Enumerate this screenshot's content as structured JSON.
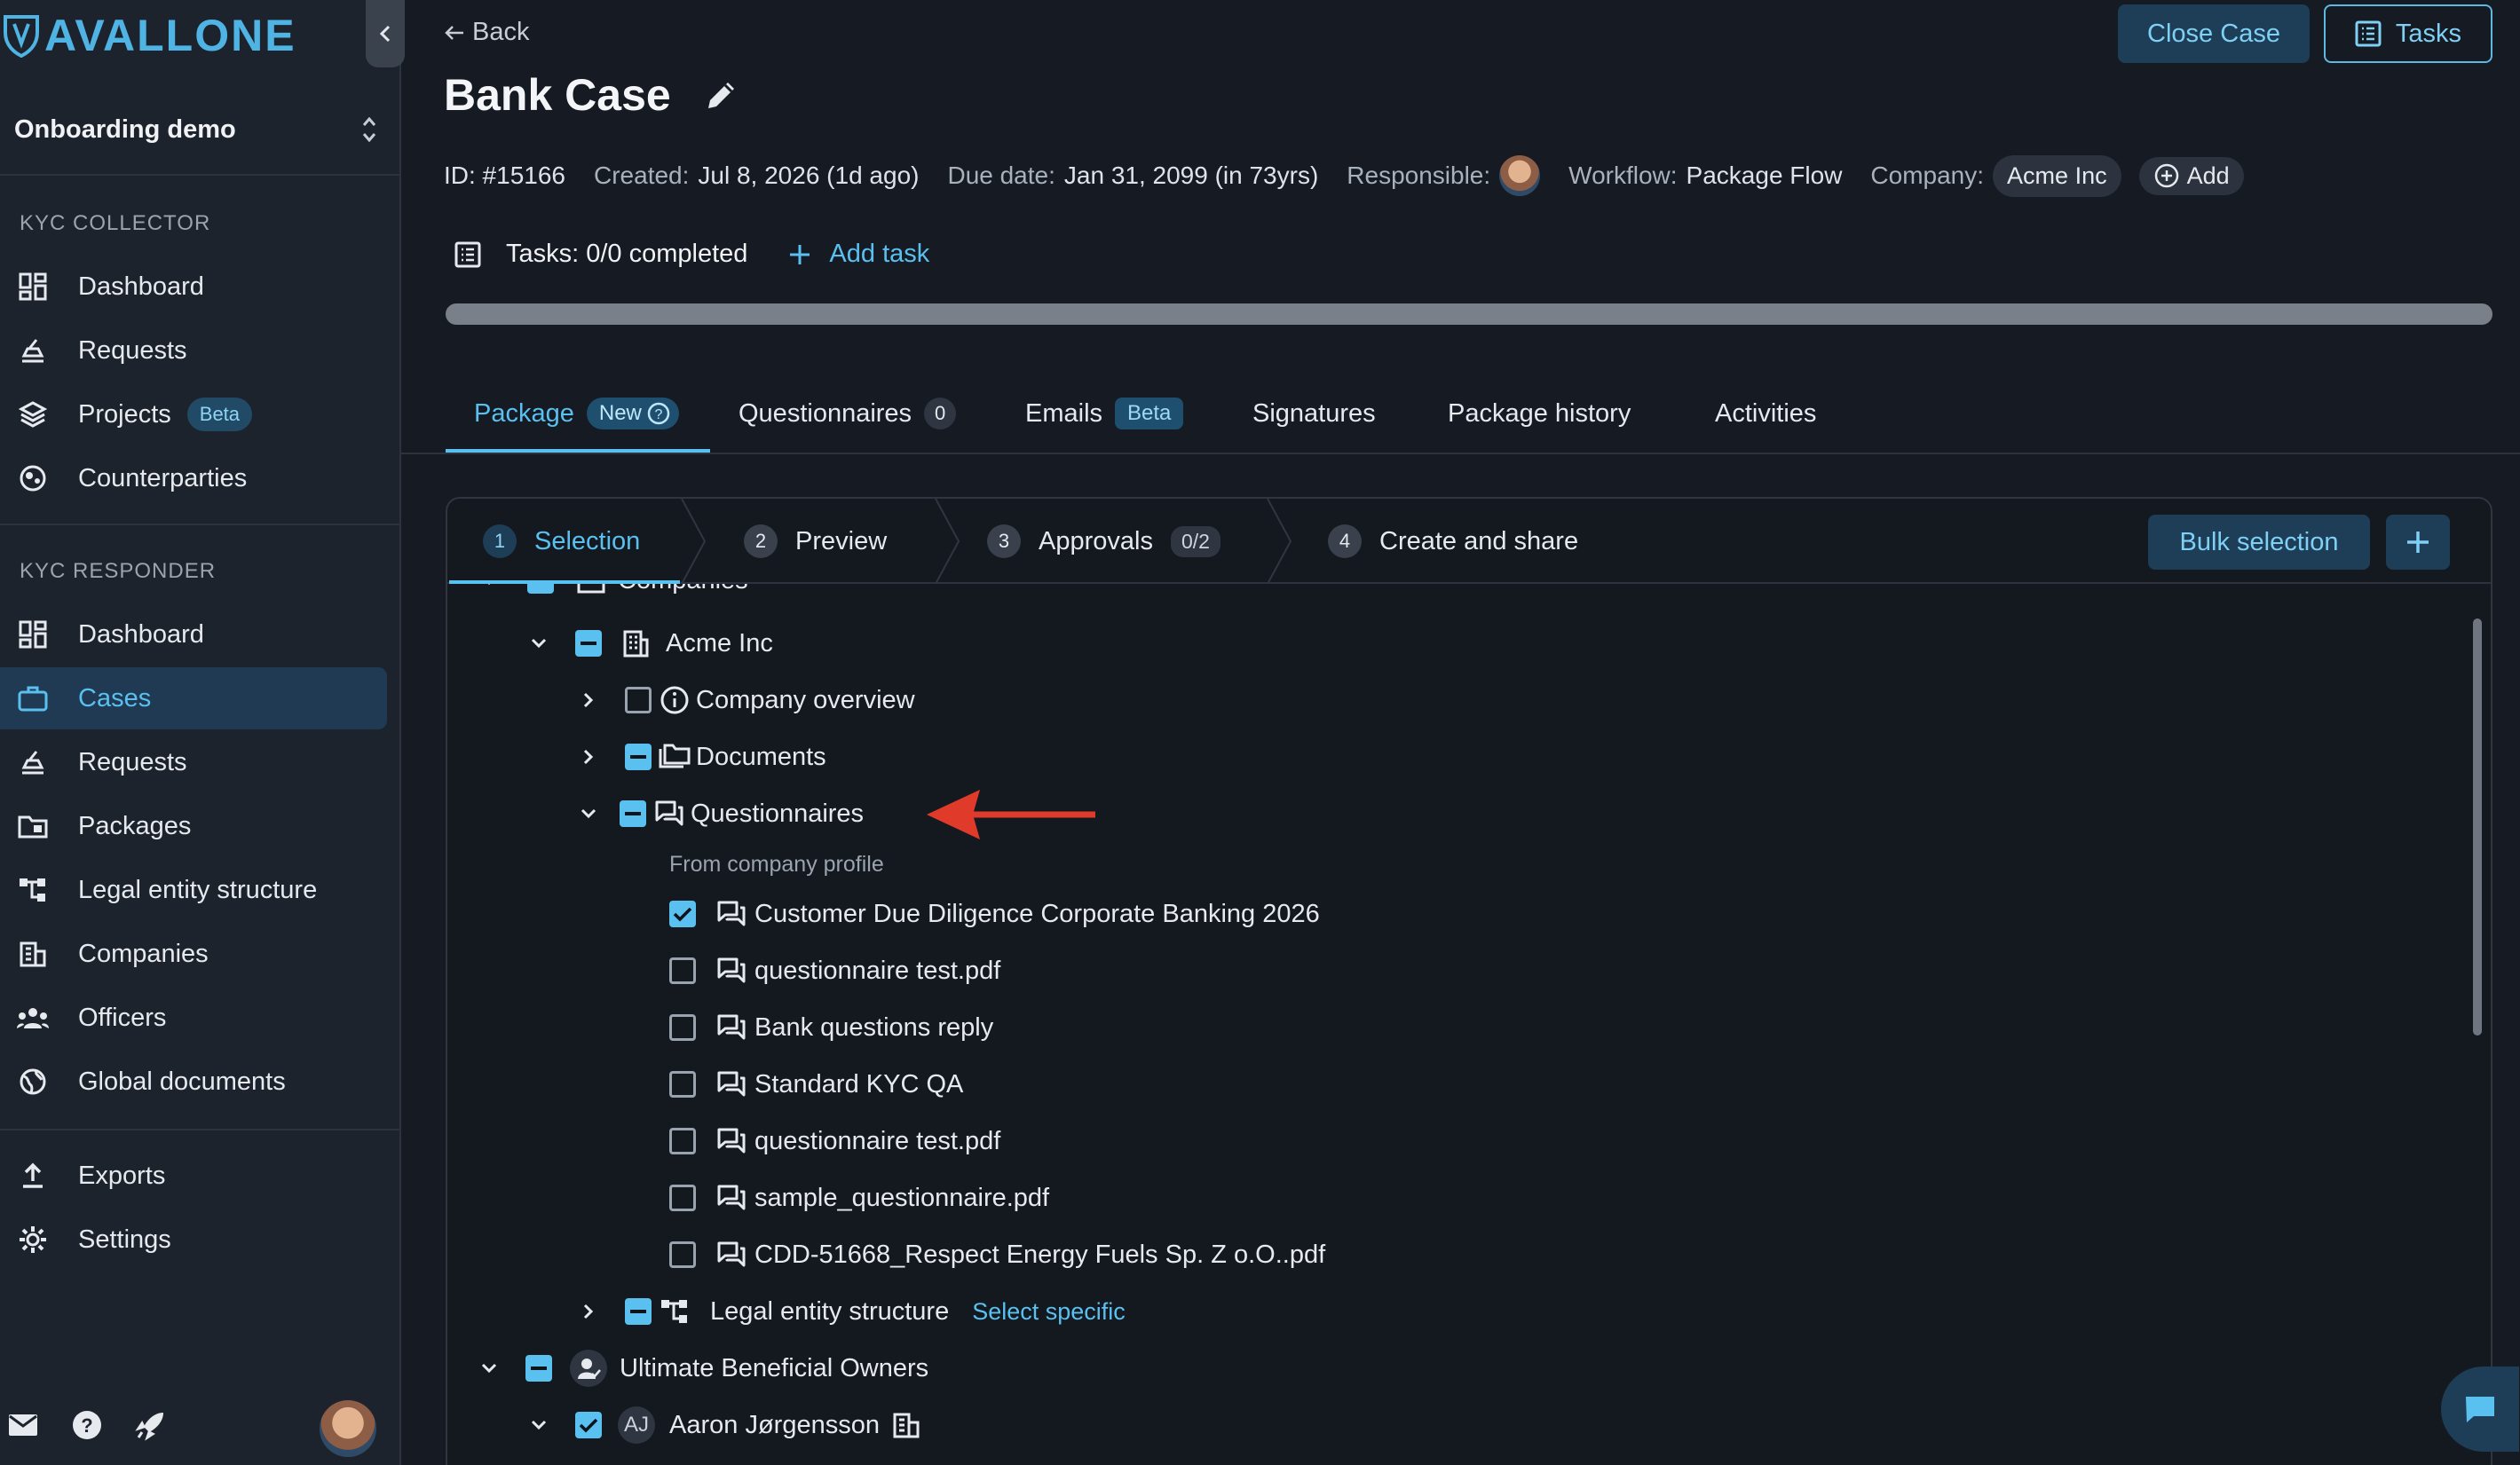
{
  "brand": {
    "logo_text": "AVALLONE",
    "accent": "#59c0f0"
  },
  "sidebar": {
    "workspace": "Onboarding demo",
    "sections": {
      "collector_title": "KYC COLLECTOR",
      "responder_title": "KYC RESPONDER"
    },
    "collector_items": [
      {
        "label": "Dashboard",
        "icon": "dashboard-icon"
      },
      {
        "label": "Requests",
        "icon": "requests-icon"
      },
      {
        "label": "Projects",
        "icon": "projects-icon",
        "badge": "Beta"
      },
      {
        "label": "Counterparties",
        "icon": "counterparties-icon"
      }
    ],
    "responder_items": [
      {
        "label": "Dashboard",
        "icon": "dashboard-icon"
      },
      {
        "label": "Cases",
        "icon": "briefcase-icon",
        "active": true
      },
      {
        "label": "Requests",
        "icon": "requests-icon"
      },
      {
        "label": "Packages",
        "icon": "packages-icon"
      },
      {
        "label": "Legal entity structure",
        "icon": "hierarchy-icon"
      },
      {
        "label": "Companies",
        "icon": "company-icon"
      },
      {
        "label": "Officers",
        "icon": "people-icon"
      },
      {
        "label": "Global documents",
        "icon": "globe-icon"
      }
    ],
    "bottom_items": [
      {
        "label": "Exports",
        "icon": "upload-icon"
      },
      {
        "label": "Settings",
        "icon": "gear-icon"
      }
    ]
  },
  "header": {
    "back_label": "Back",
    "close_case_label": "Close Case",
    "tasks_label": "Tasks",
    "title": "Bank Case",
    "meta": {
      "id": "ID: #15166",
      "created_key": "Created:",
      "created_val": "Jul 8, 2026 (1d ago)",
      "due_key": "Due date:",
      "due_val": "Jan 31, 2099 (in 73yrs)",
      "responsible_key": "Responsible:",
      "workflow_key": "Workflow:",
      "workflow_val": "Package Flow",
      "company_key": "Company:",
      "company_val": "Acme Inc",
      "add_label": "Add"
    },
    "tasks_summary": "Tasks: 0/0 completed",
    "add_task_label": "Add task",
    "progress": 0
  },
  "tabs": [
    {
      "label": "Package",
      "badge": "New",
      "active": true
    },
    {
      "label": "Questionnaires",
      "count": "0"
    },
    {
      "label": "Emails",
      "badge": "Beta"
    },
    {
      "label": "Signatures"
    },
    {
      "label": "Package history"
    },
    {
      "label": "Activities"
    }
  ],
  "stepper": {
    "steps": [
      {
        "num": "1",
        "label": "Selection",
        "active": true
      },
      {
        "num": "2",
        "label": "Preview"
      },
      {
        "num": "3",
        "label": "Approvals",
        "count": "0/2"
      },
      {
        "num": "4",
        "label": "Create and share"
      }
    ],
    "bulk_label": "Bulk selection"
  },
  "tree": {
    "companies_label": "Companies",
    "acme_label": "Acme Inc",
    "company_overview": "Company overview",
    "documents": "Documents",
    "questionnaires": "Questionnaires",
    "from_profile": "From company profile",
    "items": [
      {
        "label": "Customer Due Diligence Corporate Banking 2026",
        "checked": true
      },
      {
        "label": "questionnaire test.pdf",
        "checked": false
      },
      {
        "label": "Bank questions reply",
        "checked": false
      },
      {
        "label": "Standard KYC QA",
        "checked": false
      },
      {
        "label": "questionnaire test.pdf",
        "checked": false
      },
      {
        "label": "sample_questionnaire.pdf",
        "checked": false
      },
      {
        "label": "CDD-51668_Respect Energy Fuels Sp. Z o.O..pdf",
        "checked": false
      }
    ],
    "legal_entity": "Legal entity structure",
    "select_specific": "Select specific",
    "ubo_label": "Ultimate Beneficial Owners",
    "person_initials": "AJ",
    "person_name": "Aaron Jørgensson"
  }
}
